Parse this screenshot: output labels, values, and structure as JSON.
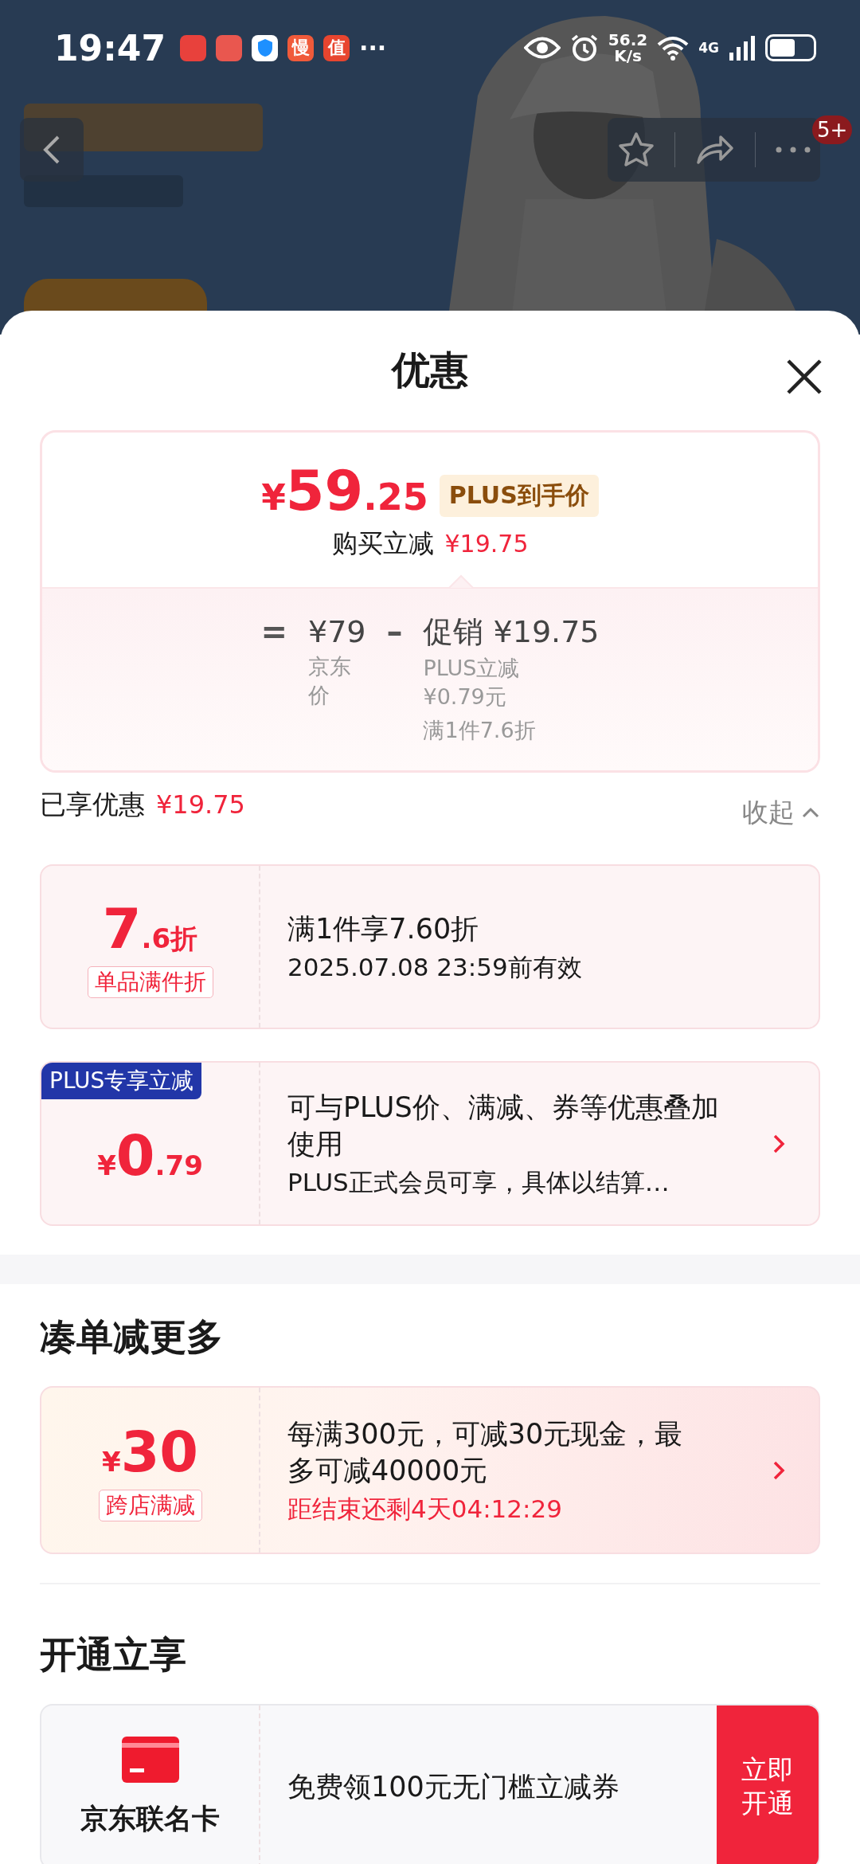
{
  "status_bar": {
    "time": "19:47",
    "app_badges": [
      "慢",
      "值"
    ],
    "more": "···",
    "net_speed": "56.2",
    "net_unit": "K/s",
    "network": "4G"
  },
  "nav": {
    "badge": "5+"
  },
  "sheet": {
    "title": "优惠"
  },
  "price_card": {
    "currency": "¥",
    "integer": "59",
    "decimal": ".25",
    "tag": "PLUS到手价",
    "saving_label": "购买立减",
    "saving_amount": "¥19.75",
    "breakdown": {
      "equals": "=",
      "base_price": "¥79",
      "base_label": "京东价",
      "minus": "–",
      "promo_label": "促销",
      "promo_amount": "¥19.75",
      "details": [
        "PLUS立减¥0.79元",
        "满1件7.6折"
      ]
    }
  },
  "summary": {
    "label": "已享优惠",
    "amount": "¥19.75",
    "toggle": "收起"
  },
  "coupons": [
    {
      "kind": "discount",
      "big": "7",
      "small": ".6折",
      "tag": "单品满件折",
      "title": "满1件享7.60折",
      "subtitle": "2025.07.08 23:59前有效",
      "arrow": false
    },
    {
      "kind": "plus",
      "ribbon": "PLUS专享立减",
      "currency": "¥",
      "big": "0",
      "small": ".79",
      "title": "可与PLUS价、满减、券等优惠叠加使用",
      "subtitle": "PLUS正式会员可享，具体以结算…",
      "arrow": true
    }
  ],
  "more_section": {
    "title": "凑单减更多",
    "coupons": [
      {
        "kind": "cash",
        "currency": "¥",
        "big": "30",
        "tag": "跨店满减",
        "title": "每满300元，可减30元现金，最多可减40000元",
        "countdown": "距结束还剩4天04:12:29",
        "arrow": true
      }
    ]
  },
  "join_section": {
    "title": "开通立享",
    "card": {
      "name": "京东联名卡",
      "offer": "免费领100元无门槛立减券",
      "button": "立即开通"
    }
  }
}
